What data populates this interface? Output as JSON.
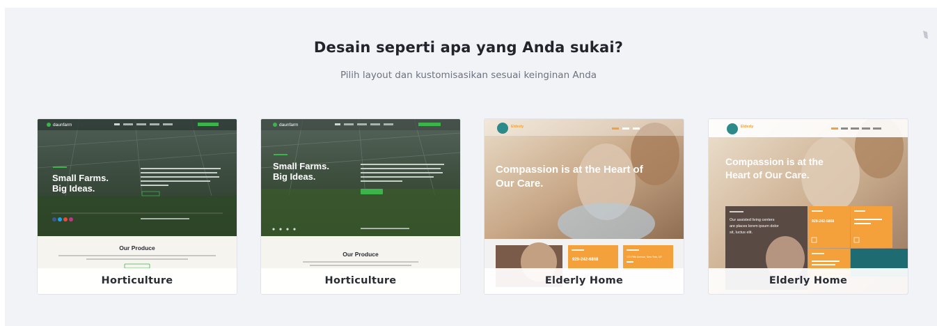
{
  "header": {
    "title": "Desain seperti apa yang Anda sukai?",
    "subtitle": "Pilih layout dan kustomisasikan sesuai keinginan Anda"
  },
  "templates": [
    {
      "label": "Horticulture",
      "preview": {
        "brand": "daunfarm",
        "headline_1": "Small Farms.",
        "headline_2": "Big Ideas.",
        "section_title": "Our Produce"
      }
    },
    {
      "label": "Horticulture",
      "preview": {
        "brand": "daunfarm",
        "headline_1": "Small Farms.",
        "headline_2": "Big Ideas.",
        "section_title": "Our Produce"
      }
    },
    {
      "label": "Elderly Home",
      "preview": {
        "brand": "Elderly",
        "headline_1": "Compassion is at the Heart of",
        "headline_2": "Our Care.",
        "phone": "929-242-6868",
        "address": "123 Fifth Avenue, New York, NY"
      }
    },
    {
      "label": "Elderly Home",
      "preview": {
        "brand": "Elderly",
        "headline_1": "Compassion is at the",
        "headline_2": "Heart of Our Care.",
        "phone": "929-242-6868",
        "info_text_1": "Our assisted living centers",
        "info_text_2": "are places lorem ipsum dolor",
        "info_text_3": "sit, luctus elit."
      }
    }
  ],
  "colors": {
    "panel_bg": "#f2f3f6",
    "accent_green": "#3bb54a",
    "accent_orange": "#f4a13b",
    "heading": "#22242b",
    "subtitle": "#6d7280"
  },
  "icons": [
    "corner-mark-icon"
  ]
}
